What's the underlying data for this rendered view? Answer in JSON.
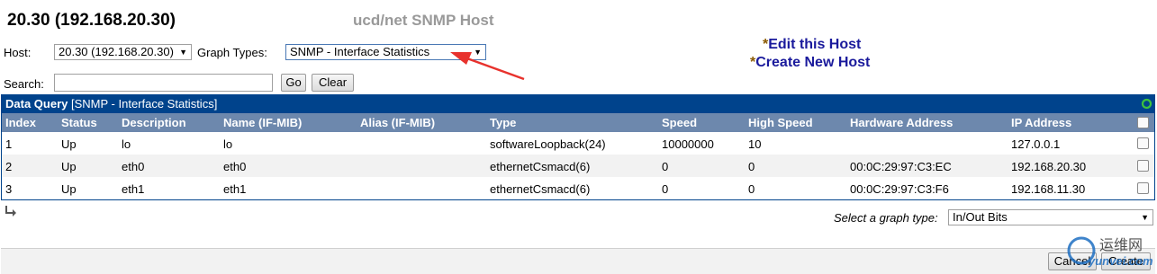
{
  "header": {
    "host_title": "20.30 (192.168.20.30)",
    "app_name": "ucd/net SNMP Host"
  },
  "filters": {
    "host_label": "Host:",
    "host_value": "20.30 (192.168.20.30)",
    "graph_types_label": "Graph Types:",
    "graph_types_value": "SNMP - Interface Statistics",
    "search_label": "Search:",
    "search_value": "",
    "go_label": "Go",
    "clear_label": "Clear"
  },
  "links": {
    "star": "*",
    "edit_host": "Edit this Host",
    "create_host": "Create New Host"
  },
  "data_query": {
    "title_bold": "Data Query",
    "title_rest": "[SNMP - Interface Statistics]",
    "columns": [
      "Index",
      "Status",
      "Description",
      "Name (IF-MIB)",
      "Alias (IF-MIB)",
      "Type",
      "Speed",
      "High Speed",
      "Hardware Address",
      "IP Address"
    ],
    "rows": [
      [
        "1",
        "Up",
        "lo",
        "lo",
        "",
        "softwareLoopback(24)",
        "10000000",
        "10",
        "",
        "127.0.0.1"
      ],
      [
        "2",
        "Up",
        "eth0",
        "eth0",
        "",
        "ethernetCsmacd(6)",
        "0",
        "0",
        "00:0C:29:97:C3:EC",
        "192.168.20.30"
      ],
      [
        "3",
        "Up",
        "eth1",
        "eth1",
        "",
        "ethernetCsmacd(6)",
        "0",
        "0",
        "00:0C:29:97:C3:F6",
        "192.168.11.30"
      ]
    ]
  },
  "graph_type": {
    "label": "Select a graph type:",
    "value": "In/Out Bits"
  },
  "footer": {
    "cancel_label": "Cancel",
    "create_label": "Create"
  },
  "watermark": {
    "text_cn": "运维网",
    "text_en": "yunvei.com"
  },
  "colors": {
    "title_bar": "#00438c",
    "header_row": "#6d88ad",
    "row_alt": "#f2f2f2",
    "annotation_arrow": "#e8322d"
  }
}
